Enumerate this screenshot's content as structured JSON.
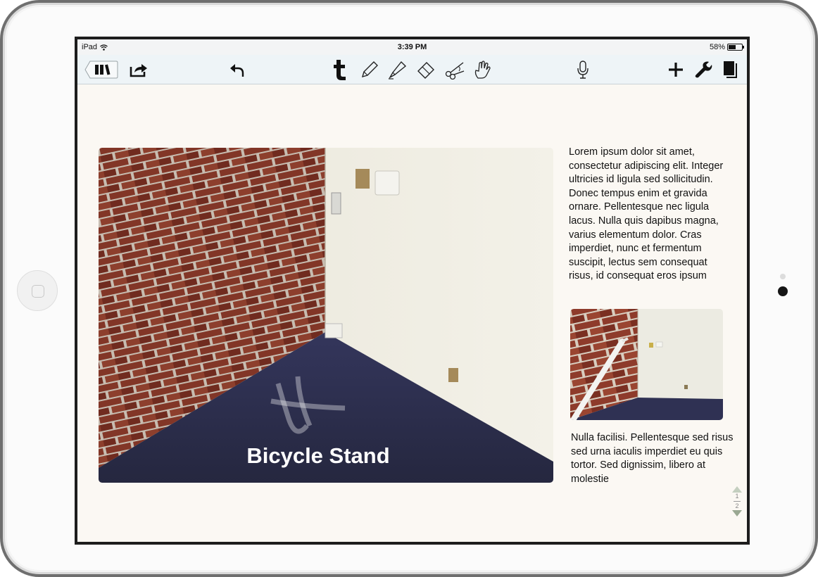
{
  "status_bar": {
    "carrier": "iPad",
    "time": "3:39 PM",
    "battery_percent": "58%",
    "battery_level": 0.58
  },
  "toolbar": {
    "icons": [
      "library-icon",
      "share-icon",
      "undo-icon",
      "text-tool-icon",
      "pen-icon",
      "highlighter-icon",
      "eraser-icon",
      "scissors-icon",
      "hand-icon",
      "microphone-icon",
      "add-icon",
      "wrench-icon",
      "pages-icon"
    ]
  },
  "page": {
    "photo_caption": "Bicycle Stand",
    "paragraph_1": "Lorem ipsum dolor sit amet, consectetur adipiscing elit. Integer ultricies id ligula sed sollicitudin. Donec tempus enim et gravida ornare. Pellentesque nec ligula lacus. Nulla quis dapibus magna, varius elementum dolor. Cras imperdiet, nunc et fermentum suscipit, lectus sem consequat risus, id consequat eros ipsum",
    "paragraph_2": "Nulla facilisi. Pellentesque sed risus sed urna iaculis imperdiet eu quis tortor. Sed dignissim, libero at molestie"
  },
  "pager": {
    "current": "1",
    "total": "2"
  },
  "colors": {
    "brick": "#8e3b2b",
    "mortar": "#d9cfc2",
    "wall": "#efede2",
    "carpet": "#2a2c4e",
    "paper": "#fbf8f3",
    "toolbar": "#eef4f7"
  }
}
